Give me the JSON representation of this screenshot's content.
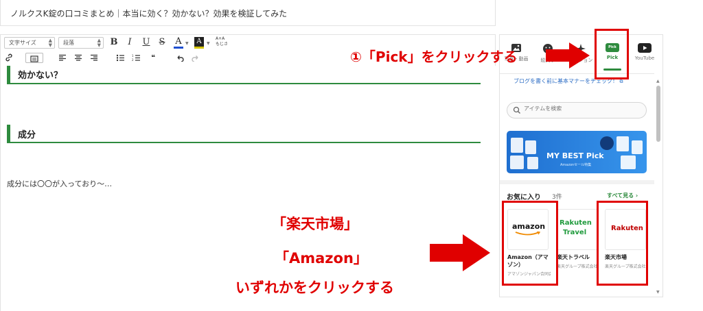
{
  "editor": {
    "title": "ノルクスK錠の口コミまとめ｜本当に効く？効かない？効果を検証してみた",
    "toolbar": {
      "font_size_select": "文字サイズ",
      "paragraph_select": "段落",
      "bold": "B",
      "italic": "I",
      "underline": "U",
      "strike": "S",
      "font_color": "A",
      "bg_color": "A",
      "ruby": "A+A",
      "ruby_sub": "もじさ",
      "quote": "❝"
    },
    "headings": [
      "効かない？",
      "成分"
    ],
    "paragraph": "成分には〇〇が入っており〜…"
  },
  "sidebar": {
    "tabs": [
      {
        "label": "写真・動画",
        "icon": "image-icon"
      },
      {
        "label": "絵文字",
        "icon": "emoji-icon"
      },
      {
        "label": "アクション",
        "icon": "sparkle-icon"
      },
      {
        "label": "Pick",
        "icon": "pick-icon",
        "badge": "Pick"
      },
      {
        "label": "YouTube",
        "icon": "youtube-icon"
      }
    ],
    "manner_link": "ブログを書く前に基本マナーをチェック！",
    "search_placeholder": "アイテムを検索",
    "banner": {
      "title": "MY BEST Pick",
      "subtitle": "Amazonセール特集"
    },
    "favorites": {
      "title": "お気に入り",
      "count": "3件",
      "see_all": "すべて見る",
      "items": [
        {
          "logo": "amazon",
          "name": "Amazon（アマゾン）",
          "company": "アマゾンジャパン合同会社"
        },
        {
          "logo": "Rakuten Travel",
          "logo_line1": "Rakuten",
          "logo_line2": "Travel",
          "name": "楽天トラベル",
          "company": "楽天グループ株式会社"
        },
        {
          "logo": "Rakuten",
          "name": "楽天市場",
          "company": "楽天グループ株式会社"
        }
      ]
    }
  },
  "annotations": {
    "step1": "①「Pick」をクリックする",
    "line1": "「楽天市場」",
    "line2": "「Amazon」",
    "line3": "いずれかをクリックする",
    "color": "#e00000"
  },
  "colors": {
    "accent_green": "#2e8b3e",
    "link_blue": "#2b6cc4",
    "annotation_red": "#e00000"
  }
}
